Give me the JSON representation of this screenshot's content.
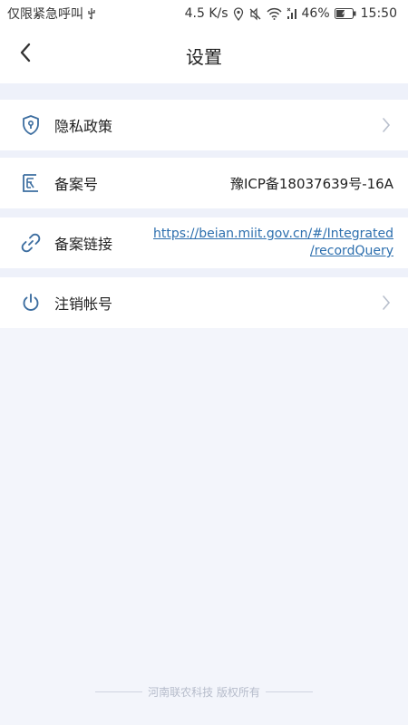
{
  "status_bar": {
    "carrier_text": "仅限紧急呼叫",
    "network_speed": "4.5 K/s",
    "battery_percent": "46%",
    "time": "15:50",
    "icons": [
      "usb-icon",
      "location-icon",
      "mute-icon",
      "wifi-icon",
      "signal-icon",
      "battery-icon"
    ]
  },
  "header": {
    "title": "设置",
    "back_icon": "chevron-left-icon"
  },
  "settings": {
    "privacy": {
      "label": "隐私政策",
      "icon": "shield-icon"
    },
    "filing_number": {
      "label": "备案号",
      "value": "豫ICP备18037639号-16A",
      "icon": "record-icon"
    },
    "filing_link": {
      "label": "备案链接",
      "url_line1": "https://beian.miit.gov.cn/#/Integrated",
      "url_line2": "/recordQuery",
      "icon": "link-icon"
    },
    "deactivate": {
      "label": "注销帐号",
      "icon": "power-icon"
    }
  },
  "footer": {
    "copyright": "河南联农科技 版权所有"
  },
  "colors": {
    "accent": "#3d6ea0",
    "link": "#2d6fae",
    "background": "#f3f5fb"
  }
}
